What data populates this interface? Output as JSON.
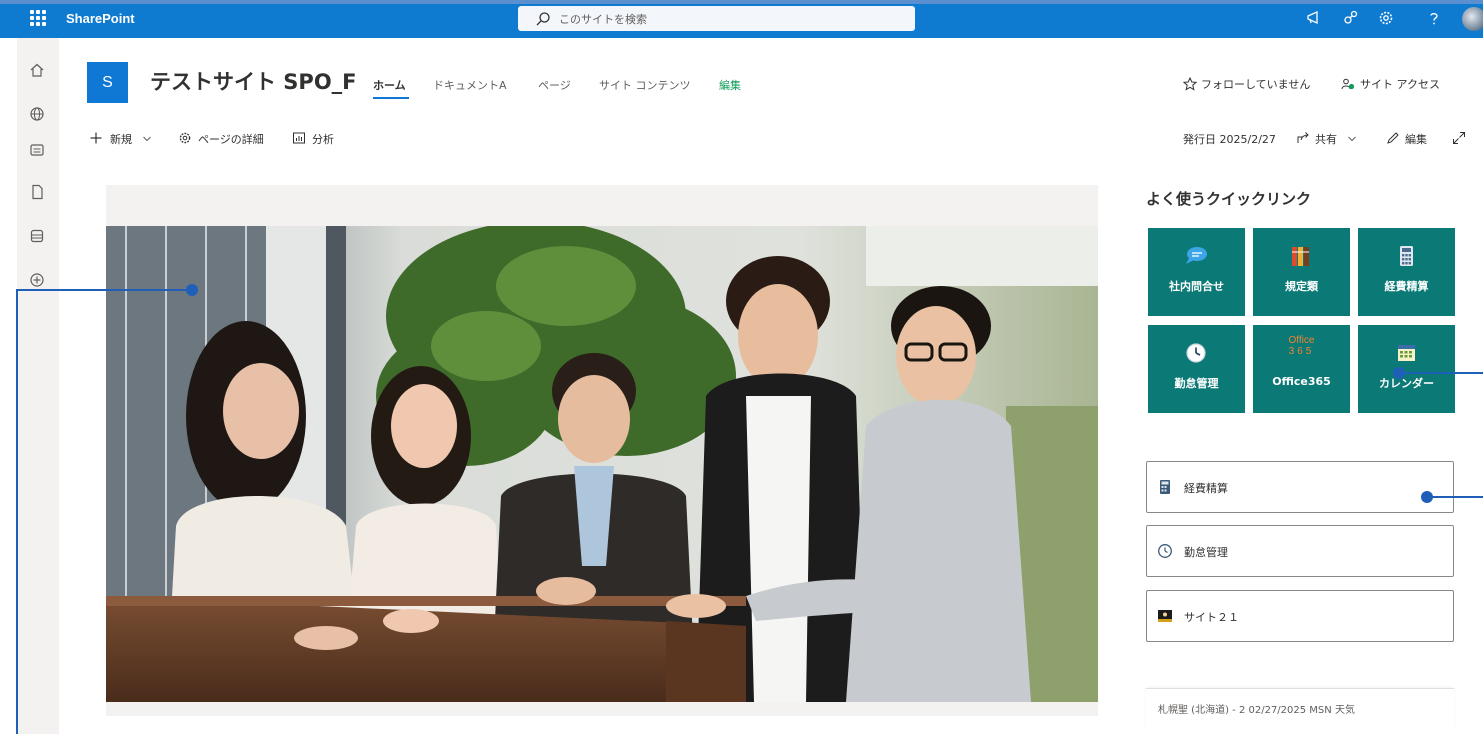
{
  "suite": {
    "app_name": "SharePoint",
    "search_placeholder": "このサイトを検索"
  },
  "site": {
    "logo_letter": "S",
    "title": "テストサイト SPO_F",
    "nav": [
      "ホーム",
      "ドキュメントA",
      "ページ",
      "サイト コンテンツ",
      "編集"
    ],
    "follow": "フォローしていません",
    "site_access": "サイト アクセス"
  },
  "command_bar": {
    "new": "新規",
    "page_details": "ページの詳細",
    "analytics": "分析",
    "published": "発行日 2025/2/27",
    "share": "共有",
    "edit": "編集"
  },
  "quick_links": {
    "title": "よく使うクイックリンク",
    "tiles": [
      {
        "label": "社内問合せ",
        "icon": "chat-bubble-icon"
      },
      {
        "label": "規定類",
        "icon": "binders-icon"
      },
      {
        "label": "経費精算",
        "icon": "calculator-icon"
      },
      {
        "label": "勤怠管理",
        "icon": "clock-icon"
      },
      {
        "label": "Office365",
        "icon": "office365-icon"
      },
      {
        "label": "カレンダー",
        "icon": "calendar-icon"
      }
    ],
    "office_logo_top": "Office",
    "office_logo_bottom": "365",
    "list": [
      {
        "label": "経費精算",
        "icon": "calculator-icon"
      },
      {
        "label": "勤怠管理",
        "icon": "clock-icon"
      },
      {
        "label": "サイト２１",
        "icon": "site-thumbnail-icon"
      }
    ]
  },
  "weather": {
    "text": "札幌聖 (北海道) - 2   02/27/2025   MSN 天気"
  },
  "colors": {
    "suite_bar": "#0f7bd0",
    "tile_teal": "#0b7a77",
    "accent": "#0f78d4",
    "annotation": "#1f5fb8"
  }
}
